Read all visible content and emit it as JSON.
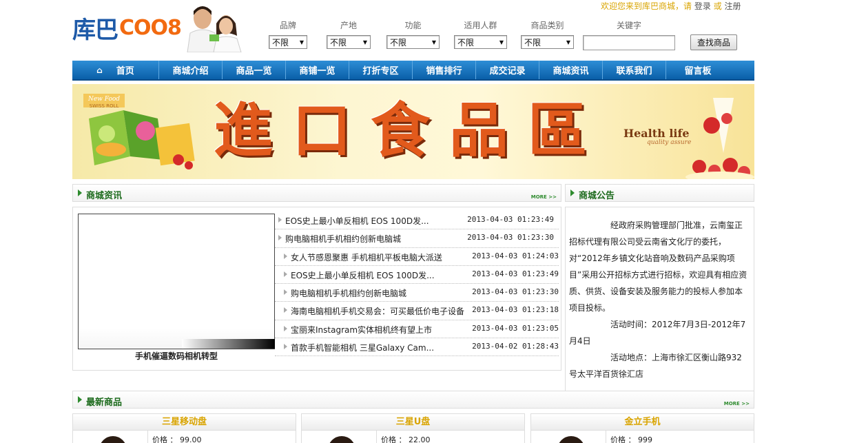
{
  "header": {
    "welcome": "欢迎您来到库巴商城，请",
    "login": "登录",
    "or": "或",
    "register": "注册",
    "logo_cn": "库巴",
    "logo_en": "COO8"
  },
  "filters": [
    {
      "label": "品牌",
      "value": "不限"
    },
    {
      "label": "产地",
      "value": "不限"
    },
    {
      "label": "功能",
      "value": "不限"
    },
    {
      "label": "适用人群",
      "value": "不限"
    },
    {
      "label": "商品类别",
      "value": "不限"
    }
  ],
  "keyword": {
    "label": "关键字",
    "value": ""
  },
  "search_button": "查找商品",
  "nav": [
    {
      "label": "首页"
    },
    {
      "label": "商城介绍"
    },
    {
      "label": "商品一览"
    },
    {
      "label": "商铺一览"
    },
    {
      "label": "打折专区"
    },
    {
      "label": "销售排行"
    },
    {
      "label": "成交记录"
    },
    {
      "label": "商城资讯"
    },
    {
      "label": "联系我们"
    },
    {
      "label": "留言板"
    }
  ],
  "banner": {
    "title": "進口食品區",
    "health": "Health life",
    "quality": "quality assure",
    "box_text_1": "New Food",
    "box_text_2": "SWISS ROLL"
  },
  "news": {
    "title": "商城资讯",
    "more": "MORE >>",
    "caption": "手机催逼数码相机转型",
    "items": [
      {
        "title": "EOS史上最小单反相机 EOS 100D发...",
        "date": "2013-04-03 01:23:49"
      },
      {
        "title": "购电脑相机手机相约创新电脑城",
        "date": "2013-04-03 01:23:30"
      },
      {
        "title": "女人节感恩聚惠 手机相机平板电脑大派送",
        "date": "2013-04-03 01:24:03"
      },
      {
        "title": "EOS史上最小单反相机 EOS 100D发...",
        "date": "2013-04-03 01:23:49"
      },
      {
        "title": "购电脑相机手机相约创新电脑城",
        "date": "2013-04-03 01:23:30"
      },
      {
        "title": "海南电脑相机手机交易会：可买最低价电子设备",
        "date": "2013-04-03 01:23:18"
      },
      {
        "title": "宝丽来Instagram实体相机终有望上市",
        "date": "2013-04-03 01:23:05"
      },
      {
        "title": "首款手机智能相机 三星Galaxy Cam...",
        "date": "2013-04-02 01:28:43"
      }
    ]
  },
  "notice": {
    "title": "商城公告",
    "p1": "经政府采购管理部门批准，云南玺正招标代理有限公司受云南省文化厅的委托，对“2012年乡镇文化站音响及数码产品采购项目”采用公开招标方式进行招标，欢迎具有相应资质、供货、设备安装及服务能力的投标人参加本项目投标。",
    "p2": "活动时间：2012年7月3日-2012年7月4日",
    "p3": "活动地点：上海市徐汇区衡山路932号太平洋百货徐汇店"
  },
  "newest": {
    "title": "最新商品",
    "more": "MORE >>",
    "products": [
      {
        "name": "三星移动盘",
        "price": "价格 ： 99.00"
      },
      {
        "name": "三星U盘",
        "price": "价格 ： 22.00"
      },
      {
        "name": "金立手机",
        "price": "价格 ： 999"
      }
    ]
  }
}
